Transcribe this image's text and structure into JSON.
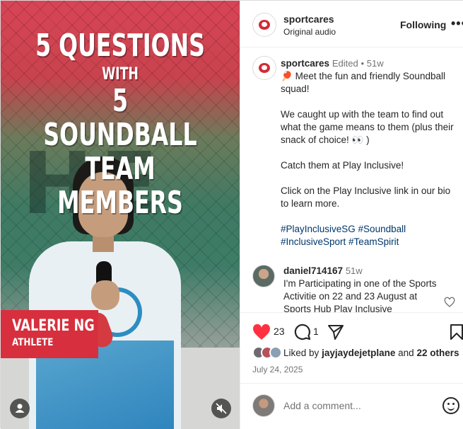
{
  "media": {
    "headline_line1": "5 QUESTIONS",
    "headline_line2": "WITH",
    "headline_line3": "5 SOUNDBALL",
    "headline_line4": "TEAM MEMBERS",
    "name": "VALERIE NG",
    "role": "ATHLETE",
    "user_icon": "person-icon",
    "mute_icon": "speaker-muted-icon"
  },
  "header": {
    "username": "sportcares",
    "subtitle": "Original audio",
    "follow_label": "Following",
    "more_label": "•••"
  },
  "caption": {
    "username": "sportcares",
    "edited": "Edited",
    "sep": "•",
    "age": "51w",
    "emoji": "🏓",
    "p1": "Meet the fun and friendly Soundball squad!",
    "p2": "We caught up with the team to find out what the game means to them (plus their snack of choice! 👀 )",
    "p3": "Catch them at Play Inclusive!",
    "p4": "Click on the Play Inclusive link in our bio to learn more.",
    "tags_line1": "#PlayInclusiveSG #Soundball",
    "tags_line2": "#InclusiveSport #TeamSpirit"
  },
  "comment": {
    "username": "daniel714167",
    "age": "51w",
    "text": "I'm Participating in one of the Sports Activitie on 22 and 23 August at Sports Hub Play Inclusive"
  },
  "actions": {
    "like_count": "23",
    "comment_count": "1"
  },
  "likes": {
    "prefix": "Liked by",
    "user": "jayjaydejetplane",
    "joiner": "and",
    "others": "22 others"
  },
  "date": "July 24, 2025",
  "composer": {
    "placeholder": "Add a comment..."
  },
  "colors": {
    "like": "#ff3040",
    "hashtag": "#00376b",
    "brand_red": "#d72f3d"
  }
}
